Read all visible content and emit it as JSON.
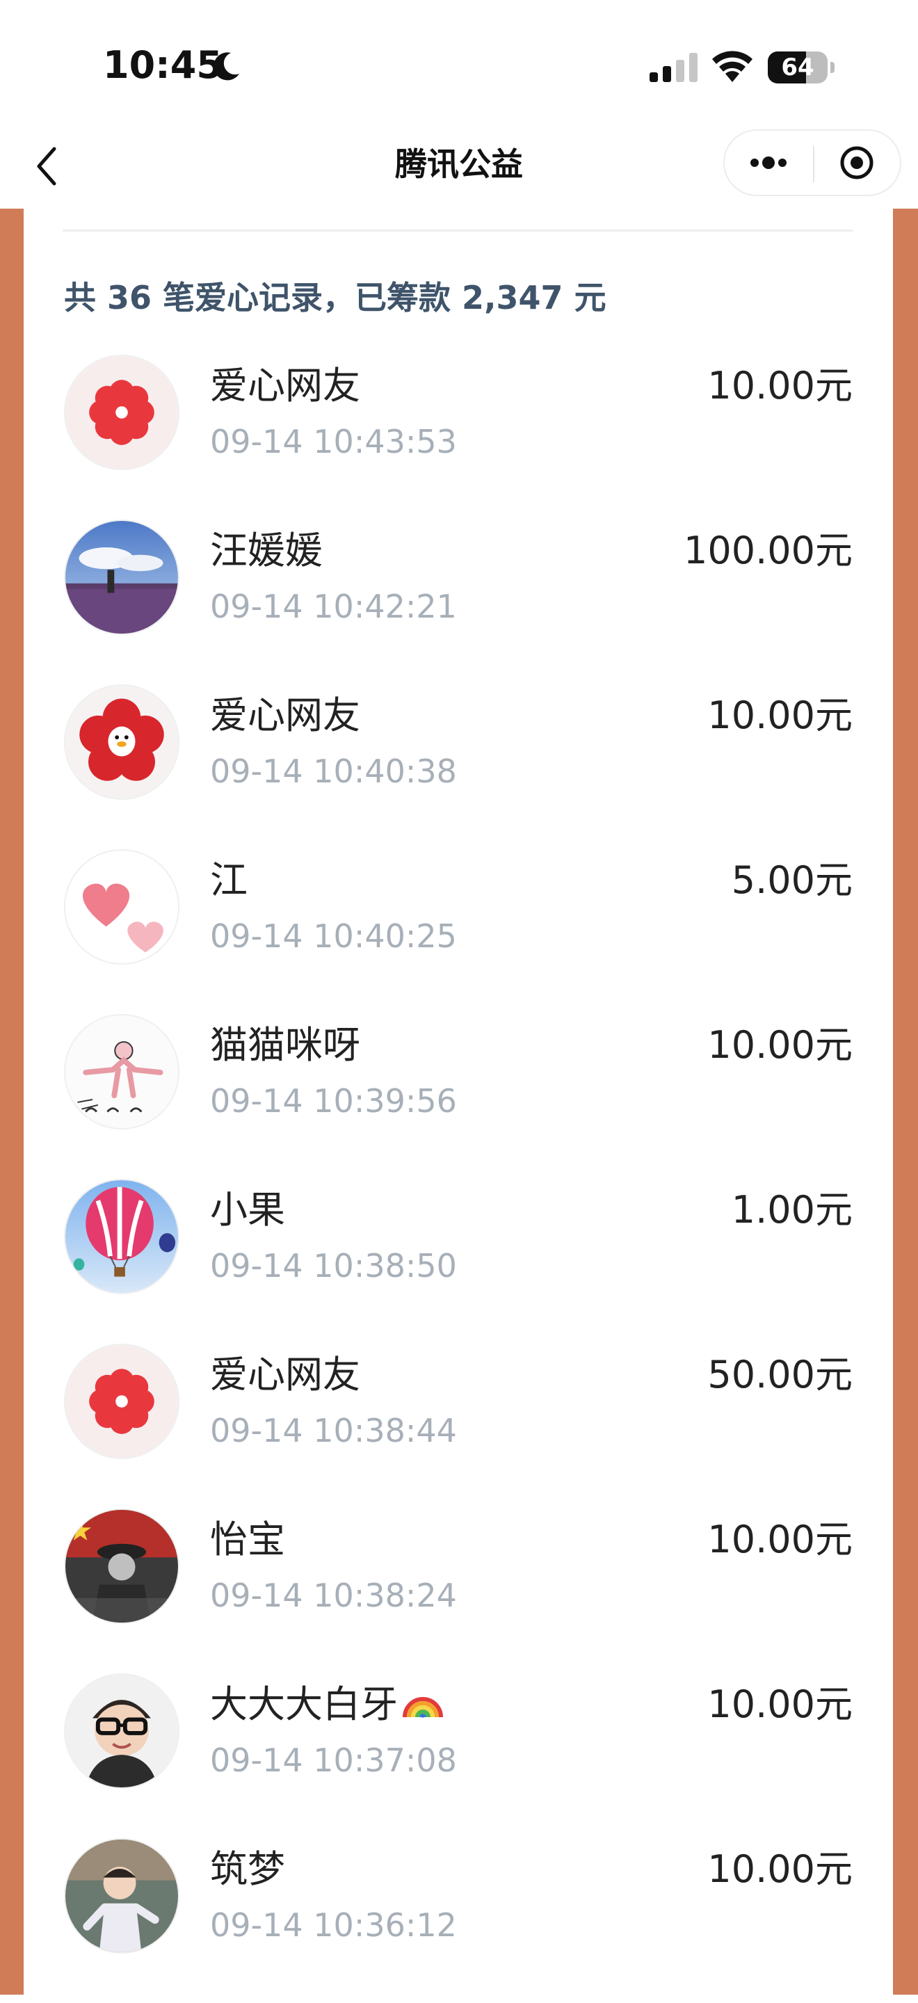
{
  "status_bar": {
    "time": "10:45",
    "battery": "64",
    "battery_level": 0.64
  },
  "nav": {
    "title": "腾讯公益"
  },
  "summary": "共 36 笔爱心记录，已筹款 2,347 元",
  "records": [
    {
      "name": "爱心网友",
      "time": "09-14 10:43:53",
      "amount": "10.00元",
      "avatar_icon": "red-flower-icon"
    },
    {
      "name": "汪媛媛",
      "time": "09-14 10:42:21",
      "amount": "100.00元",
      "avatar_icon": "landscape-photo"
    },
    {
      "name": "爱心网友",
      "time": "09-14 10:40:38",
      "amount": "10.00元",
      "avatar_icon": "penguin-flower-icon"
    },
    {
      "name": "江",
      "time": "09-14 10:40:25",
      "amount": "5.00元",
      "avatar_icon": "pink-hearts-icon"
    },
    {
      "name": "猫猫咪呀",
      "time": "09-14 10:39:56",
      "amount": "10.00元",
      "avatar_icon": "ha-ha-ha-drawing"
    },
    {
      "name": "小果",
      "time": "09-14 10:38:50",
      "amount": "1.00元",
      "avatar_icon": "hot-air-balloon-icon"
    },
    {
      "name": "爱心网友",
      "time": "09-14 10:38:44",
      "amount": "50.00元",
      "avatar_icon": "red-flower-icon"
    },
    {
      "name": "怡宝",
      "time": "09-14 10:38:24",
      "amount": "10.00元",
      "avatar_icon": "soldier-photo"
    },
    {
      "name": "大大大白牙",
      "time": "09-14 10:37:08",
      "amount": "10.00元",
      "avatar_icon": "child-glasses-photo",
      "emoji": "rainbow-icon"
    },
    {
      "name": "筑梦",
      "time": "09-14 10:36:12",
      "amount": "10.00元",
      "avatar_icon": "toddler-photo"
    }
  ]
}
